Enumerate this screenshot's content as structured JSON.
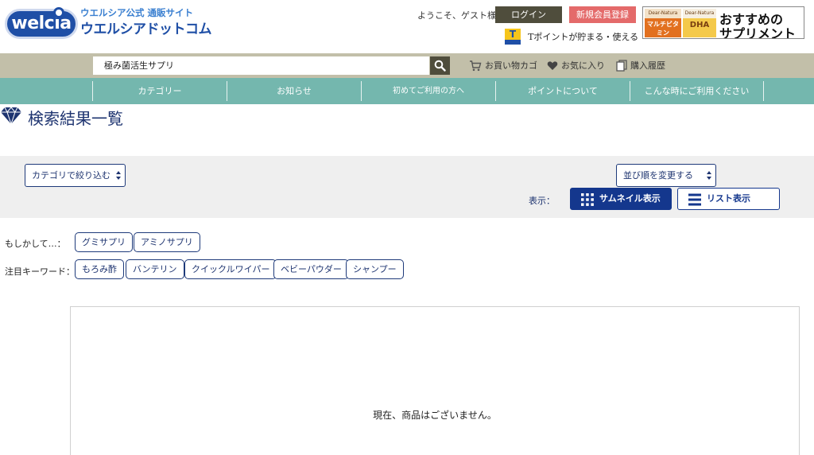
{
  "header": {
    "logo": {
      "badge": "welcia",
      "sub": "ウエルシア公式 通販サイト",
      "main": "ウエルシアドットコム"
    },
    "welcome": "ようこそ、ゲスト様",
    "login_label": "ログイン",
    "register_label": "新規会員登録",
    "tpoint_text": "Tポイントが貯まる・使える",
    "banner": {
      "product1_top": "Dear-Natura",
      "product1_name": "マルチビタミン",
      "product2_top": "Dear-Natura",
      "product2_name": "DHA",
      "line1": "おすすめの",
      "line2": "サプリメント"
    }
  },
  "search": {
    "value": "極み菌活生サプリ",
    "cart_label": "お買い物カゴ",
    "favorites_label": "お気に入り",
    "history_label": "購入履歴"
  },
  "nav": {
    "items": [
      {
        "label": "カテゴリー"
      },
      {
        "label": "お知らせ"
      },
      {
        "label": "初めてご利用の方へ"
      },
      {
        "label": "ポイントについて"
      },
      {
        "label": "こんな時にご利用ください"
      }
    ]
  },
  "page": {
    "title": "検索結果一覧"
  },
  "filter": {
    "category_select": "カテゴリで絞り込む",
    "sort_select": "並び順を変更する",
    "view_label": "表示：",
    "thumbnail_label": "サムネイル表示",
    "list_label": "リスト表示"
  },
  "suggestions": {
    "did_you_mean_label": "もしかして…：",
    "did_you_mean": [
      "グミサプリ",
      "アミノサプリ"
    ],
    "keywords_label": "注目キーワード：",
    "keywords": [
      "もろみ酢",
      "バンテリン",
      "クイックルワイパー",
      "ベビーパウダー",
      "シャンプー"
    ]
  },
  "results": {
    "empty_message": "現在、商品はございません。"
  },
  "colors": {
    "brand_blue": "#1f4fa6",
    "search_bar": "#c2bfa9",
    "nav_teal": "#74b7ae",
    "login_bg": "#4f4d3c",
    "register_bg": "#e46a6a",
    "title_navy": "#1e3470"
  }
}
